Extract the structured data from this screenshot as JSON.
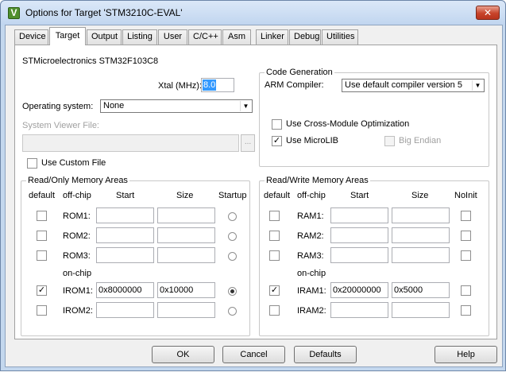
{
  "window": {
    "title": "Options for Target 'STM3210C-EVAL'",
    "app_icon_letter": "V",
    "close_label": "✕"
  },
  "tabs": [
    {
      "label": "Device"
    },
    {
      "label": "Target"
    },
    {
      "label": "Output"
    },
    {
      "label": "Listing"
    },
    {
      "label": "User"
    },
    {
      "label": "C/C++"
    },
    {
      "label": "Asm"
    },
    {
      "label": "Linker"
    },
    {
      "label": "Debug"
    },
    {
      "label": "Utilities"
    }
  ],
  "active_tab": "Target",
  "device_name": "STMicroelectronics STM32F103C8",
  "xtal": {
    "label": "Xtal (MHz):",
    "value": "8.0"
  },
  "os": {
    "label": "Operating system:",
    "value": "None"
  },
  "svf": {
    "label": "System Viewer File:",
    "value": "",
    "browse_label": "..."
  },
  "use_custom_file": {
    "label": "Use Custom File",
    "checked": false
  },
  "code_gen": {
    "title": "Code Generation",
    "arm_compiler_label": "ARM Compiler:",
    "arm_compiler_value": "Use default compiler version 5",
    "cross_module": {
      "label": "Use Cross-Module Optimization",
      "checked": false
    },
    "microlib": {
      "label": "Use MicroLIB",
      "checked": true,
      "check_glyph": "✓"
    },
    "big_endian": {
      "label": "Big Endian",
      "checked": false
    }
  },
  "rom": {
    "title": "Read/Only Memory Areas",
    "headers": {
      "default": "default",
      "offchip": "off-chip",
      "start": "Start",
      "size": "Size",
      "last": "Startup"
    },
    "onchip_label": "on-chip",
    "rows": [
      {
        "name": "ROM1:",
        "default": false,
        "start": "",
        "size": "",
        "startup": false
      },
      {
        "name": "ROM2:",
        "default": false,
        "start": "",
        "size": "",
        "startup": false
      },
      {
        "name": "ROM3:",
        "default": false,
        "start": "",
        "size": "",
        "startup": false
      },
      {
        "name": "IROM1:",
        "default": true,
        "start": "0x8000000",
        "size": "0x10000",
        "startup": true
      },
      {
        "name": "IROM2:",
        "default": false,
        "start": "",
        "size": "",
        "startup": false
      }
    ]
  },
  "ram": {
    "title": "Read/Write Memory Areas",
    "headers": {
      "default": "default",
      "offchip": "off-chip",
      "start": "Start",
      "size": "Size",
      "last": "NoInit"
    },
    "onchip_label": "on-chip",
    "rows": [
      {
        "name": "RAM1:",
        "default": false,
        "start": "",
        "size": "",
        "noinit": false
      },
      {
        "name": "RAM2:",
        "default": false,
        "start": "",
        "size": "",
        "noinit": false
      },
      {
        "name": "RAM3:",
        "default": false,
        "start": "",
        "size": "",
        "noinit": false
      },
      {
        "name": "IRAM1:",
        "default": true,
        "start": "0x20000000",
        "size": "0x5000",
        "noinit": false
      },
      {
        "name": "IRAM2:",
        "default": false,
        "start": "",
        "size": "",
        "noinit": false
      }
    ]
  },
  "buttons": {
    "ok": "OK",
    "cancel": "Cancel",
    "defaults": "Defaults",
    "help": "Help"
  }
}
